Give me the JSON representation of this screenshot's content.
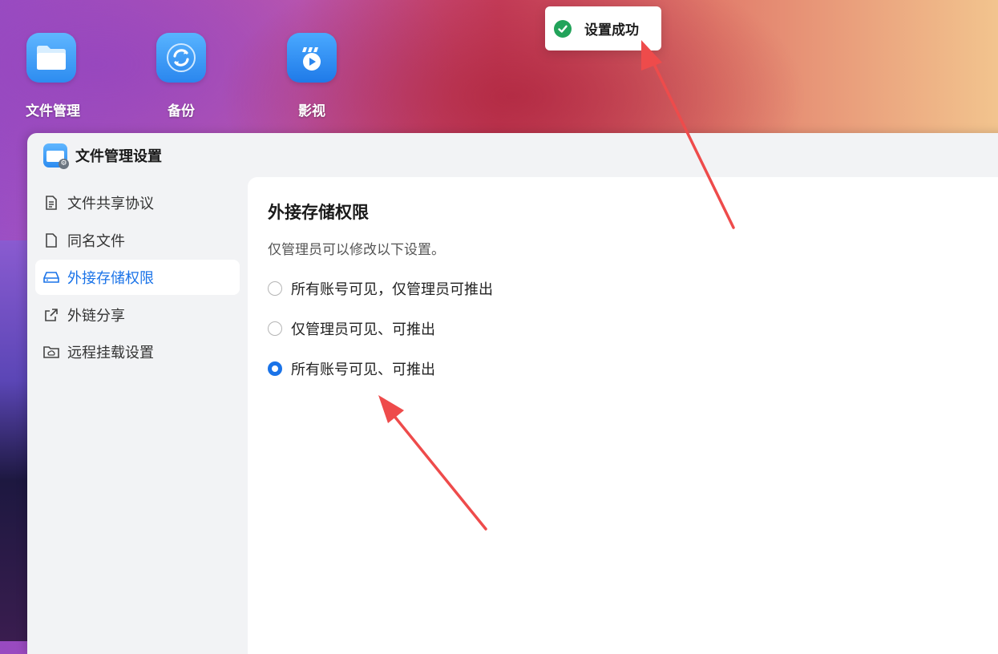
{
  "desktop": {
    "icons": [
      {
        "label": "文件管理",
        "icon": "folder-icon"
      },
      {
        "label": "备份",
        "icon": "sync-icon"
      },
      {
        "label": "影视",
        "icon": "film-play-icon"
      }
    ]
  },
  "toast": {
    "text": "设置成功",
    "icon": "check-circle-icon",
    "color": "#22a35a"
  },
  "window": {
    "title": "文件管理设置",
    "sidebar": {
      "items": [
        {
          "label": "文件共享协议",
          "icon": "document-icon",
          "active": false
        },
        {
          "label": "同名文件",
          "icon": "file-icon",
          "active": false
        },
        {
          "label": "外接存储权限",
          "icon": "drive-icon",
          "active": true
        },
        {
          "label": "外链分享",
          "icon": "share-icon",
          "active": false
        },
        {
          "label": "远程挂载设置",
          "icon": "cloud-folder-icon",
          "active": false
        }
      ]
    },
    "content": {
      "heading": "外接存储权限",
      "description": "仅管理员可以修改以下设置。",
      "options": [
        {
          "label": "所有账号可见，仅管理员可推出",
          "selected": false
        },
        {
          "label": "仅管理员可见、可推出",
          "selected": false
        },
        {
          "label": "所有账号可见、可推出",
          "selected": true
        }
      ]
    }
  },
  "accent_color": "#1a73e8",
  "annotation_color": "#ee4b4b"
}
